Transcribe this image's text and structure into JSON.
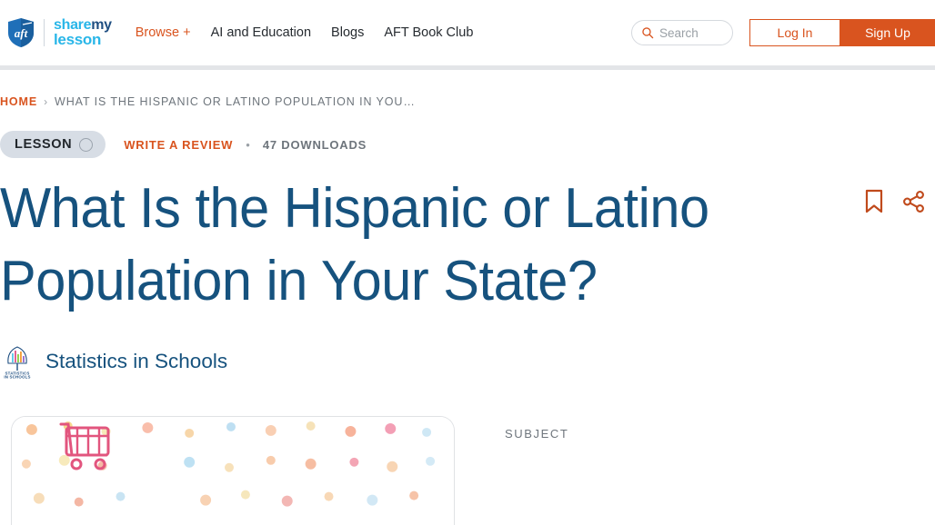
{
  "header": {
    "logo": {
      "shield_text": "aft",
      "word_line1_a": "share",
      "word_line1_b": "my",
      "word_line2": "lesson"
    },
    "nav": [
      {
        "label": "Browse +",
        "name": "nav-browse",
        "accent": true
      },
      {
        "label": "AI and Education",
        "name": "nav-ai-and-education",
        "accent": false
      },
      {
        "label": "Blogs",
        "name": "nav-blogs",
        "accent": false
      },
      {
        "label": "AFT Book Club",
        "name": "nav-aft-book-club",
        "accent": false
      }
    ],
    "search": {
      "placeholder": "Search",
      "value": ""
    },
    "login_label": "Log In",
    "signup_label": "Sign Up"
  },
  "breadcrumb": {
    "home": "HOME",
    "separator": "›",
    "current": "WHAT IS THE HISPANIC OR LATINO POPULATION IN YOU…"
  },
  "meta": {
    "type_badge": "LESSON",
    "write_review": "WRITE A REVIEW",
    "separator": "•",
    "downloads": "47 DOWNLOADS"
  },
  "page_title": "What Is the Hispanic or Latino Population in Your State?",
  "actions": {
    "bookmark": "bookmark-icon",
    "share": "share-icon"
  },
  "author": {
    "name": "Statistics in Schools",
    "logo_line1": "STATISTICS",
    "logo_line2": "IN SCHOOLS"
  },
  "sidebar": {
    "subject_label": "SUBJECT"
  },
  "colors": {
    "accent_orange": "#d9541f",
    "title_blue": "#16527e",
    "logo_cyan": "#29b6e8",
    "logo_navy": "#1f4f82",
    "badge_bg": "#d7dde5",
    "muted_text": "#6e757c"
  }
}
